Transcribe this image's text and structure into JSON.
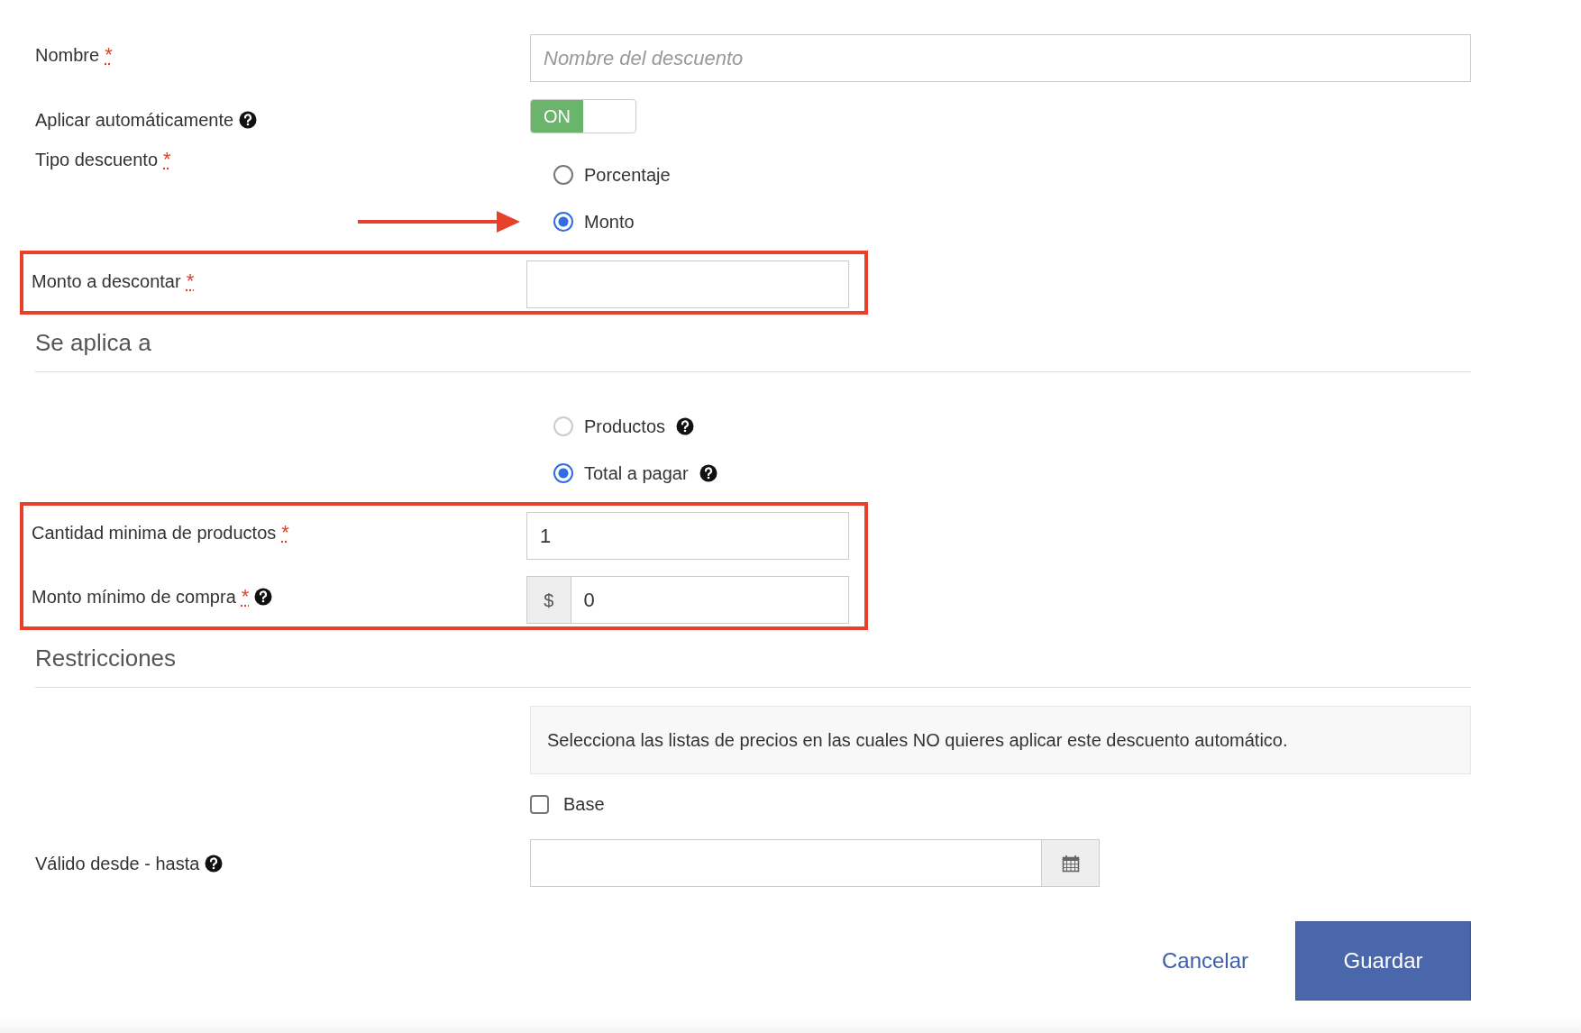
{
  "fields": [
    {
      "kind": "text",
      "label": "Nombre",
      "required_mark": "*",
      "placeholder": "Nombre del descuento",
      "highlighted": false
    },
    {
      "kind": "toggle",
      "label": "Aplicar automáticamente",
      "help": true,
      "on": true,
      "on_label": "ON"
    },
    {
      "kind": "radio",
      "label": "Tipo descuento",
      "required_mark": "*",
      "options": [
        {
          "label": "Porcentaje",
          "selected": false,
          "arrow": false
        },
        {
          "label": "Monto",
          "selected": true,
          "arrow": true
        }
      ]
    },
    {
      "kind": "text",
      "label": "Monto a descontar",
      "required_mark": "*",
      "highlighted": true
    },
    {
      "kind": "section",
      "title": "Se aplica a"
    },
    {
      "kind": "radio",
      "options": [
        {
          "label": "Productos",
          "selected": false,
          "help": true,
          "disabled": true
        },
        {
          "label": "Total a pagar",
          "selected": true,
          "help": true
        }
      ]
    },
    {
      "kind": "text",
      "label": "Cantidad minima de productos",
      "required_mark": "*",
      "value": "1",
      "highlighted": true
    },
    {
      "kind": "text",
      "label": "Monto mínimo de compra",
      "required_mark": "*",
      "help": true,
      "prefix": "$",
      "value": "0",
      "highlighted": true
    },
    {
      "kind": "section",
      "title": "Restricciones"
    },
    {
      "kind": "info",
      "text": "Selecciona las listas de precios en las cuales NO quieres aplicar este descuento automático."
    },
    {
      "kind": "checkbox",
      "label": "Base",
      "checked": false
    },
    {
      "kind": "date",
      "label": "Válido desde - hasta",
      "help": true
    }
  ],
  "actions": {
    "cancel": "Cancelar",
    "save": "Guardar"
  }
}
